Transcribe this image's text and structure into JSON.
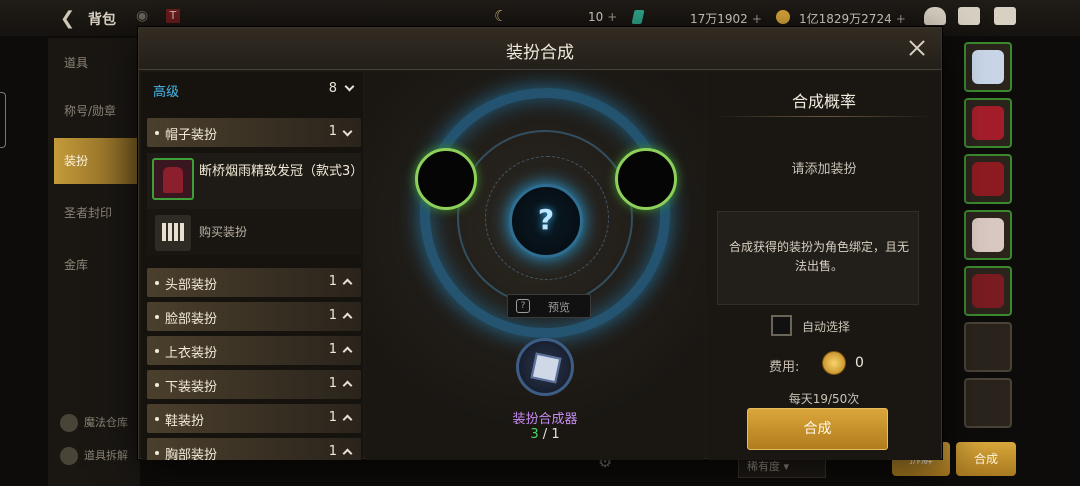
{
  "topbar": {
    "title": "背包",
    "res1": "10",
    "res2": "17万1902",
    "res3": "1亿1829万2724",
    "plus": "+"
  },
  "leftnav": {
    "items": [
      "道具",
      "称号/勋章",
      "装扮",
      "圣者封印",
      "金库"
    ],
    "bottom": [
      "魔法仓库",
      "道具拆解"
    ]
  },
  "bottom": {
    "rarity_select": "稀有度",
    "btn1": "拆解",
    "btn2": "合成"
  },
  "modal": {
    "title": "装扮合成",
    "list": {
      "tier": {
        "label": "高级",
        "count": "8"
      },
      "categories": [
        {
          "name": "帽子装扮",
          "count": "1"
        },
        {
          "name": "头部装扮",
          "count": "1"
        },
        {
          "name": "脸部装扮",
          "count": "1"
        },
        {
          "name": "上衣装扮",
          "count": "1"
        },
        {
          "name": "下装装扮",
          "count": "1"
        },
        {
          "name": "鞋装扮",
          "count": "1"
        },
        {
          "name": "胸部装扮",
          "count": "1"
        }
      ],
      "item_name": "断桥烟雨精致发冠（款式3）",
      "buy_label": "购买装扮"
    },
    "center": {
      "question": "?",
      "preview": "预览",
      "synth_name": "装扮合成器",
      "have": "3",
      "need": "1"
    },
    "rate": {
      "title": "合成概率",
      "hint": "请添加装扮",
      "notice": "合成获得的装扮为角色绑定，且无法出售。",
      "auto_select": "自动选择",
      "fee_label": "费用:",
      "fee_value": "0",
      "daily": "每天19/50次",
      "button": "合成"
    }
  },
  "colors": {
    "accent_gold": "#c49a3a",
    "tier_blue": "#49b7e8",
    "synth_purple": "#c58bf0",
    "count_green": "#46d66a"
  }
}
